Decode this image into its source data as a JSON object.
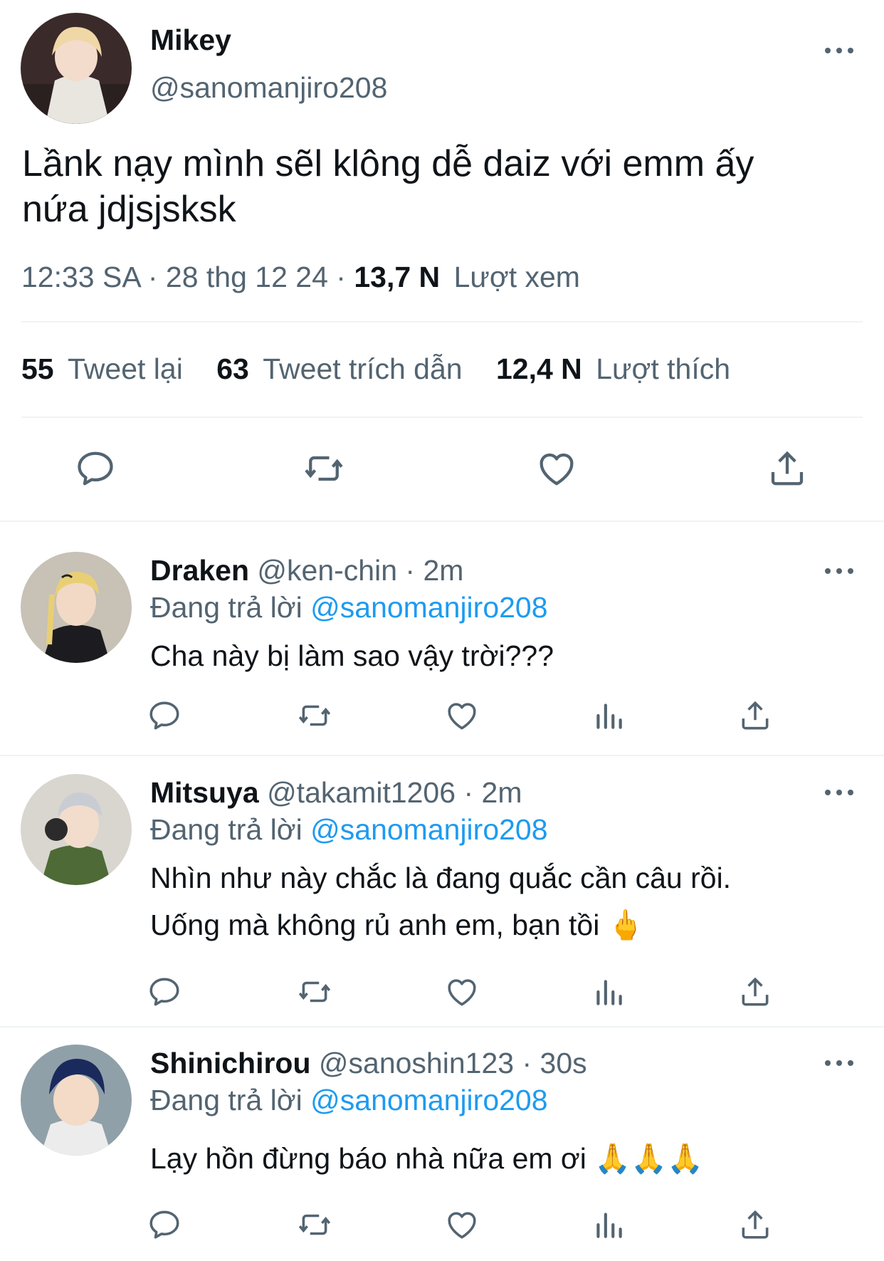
{
  "main_tweet": {
    "name": "Mikey",
    "handle": "@sanomanjiro208",
    "text_line1": "Lầnk nạy mình sẽl klông dễ daiz với emm ấy",
    "text_line2": "nứa jdjsjsksk",
    "time": "12:33 SA",
    "date": "28 thg 12 24",
    "views_count": "13,7 N",
    "views_label": "Lượt xem",
    "retweets_count": "55",
    "retweets_label": "Tweet lại",
    "quotes_count": "63",
    "quotes_label": "Tweet trích dẫn",
    "likes_count": "12,4 N",
    "likes_label": "Lượt thích",
    "dot": "·"
  },
  "replies": [
    {
      "name": "Draken",
      "handle": "@ken-chin",
      "time": "2m",
      "replying_label": "Đang trả lời",
      "replying_to": "@sanomanjiro208",
      "text_line1": "Cha này bị làm sao vậy trời???",
      "text_line2": "",
      "dot": "·"
    },
    {
      "name": "Mitsuya",
      "handle": "@takamit1206",
      "time": "2m",
      "replying_label": "Đang trả lời",
      "replying_to": "@sanomanjiro208",
      "text_line1": "Nhìn như này chắc là đang quắc cần câu rồi.",
      "text_line2": "Uống mà không rủ anh em, bạn tồi 🖕",
      "dot": "·"
    },
    {
      "name": "Shinichirou",
      "handle": "@sanoshin123",
      "time": "30s",
      "replying_label": "Đang trả lời",
      "replying_to": "@sanomanjiro208",
      "text_line1": "Lạy hồn đừng báo nhà nữa em ơi 🙏🙏🙏",
      "text_line2": "",
      "dot": "·"
    }
  ],
  "colors": {
    "accent": "#1d9bf0",
    "muted": "#536471",
    "text": "#0f1419",
    "divider": "#eff3f4"
  }
}
